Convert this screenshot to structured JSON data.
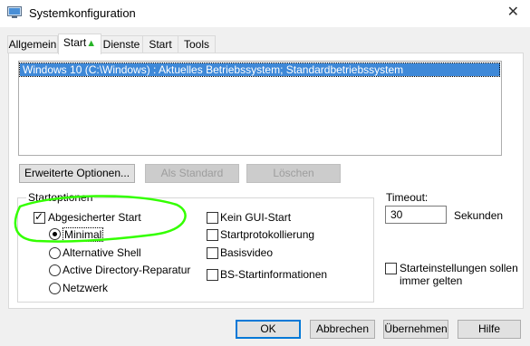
{
  "window": {
    "title": "Systemkonfiguration",
    "close_glyph": "✕"
  },
  "tabs": [
    {
      "label": "Allgemein"
    },
    {
      "label": "Start"
    },
    {
      "label": "Dienste"
    },
    {
      "label": "Start"
    },
    {
      "label": "Tools"
    }
  ],
  "os_list": {
    "items": [
      "Windows 10 (C:\\Windows) : Aktuelles Betriebssystem; Standardbetriebssystem"
    ]
  },
  "buttons": {
    "advanced": "Erweiterte Optionen...",
    "set_default": "Als Standard",
    "delete": "Löschen",
    "ok": "OK",
    "cancel": "Abbrechen",
    "apply": "Übernehmen",
    "help": "Hilfe"
  },
  "boot_options": {
    "group_title": "Startoptionen",
    "safe_boot": "Abgesicherter Start",
    "minimal": "Minimal",
    "alt_shell": "Alternative Shell",
    "ad_repair": "Active Directory-Reparatur",
    "network": "Netzwerk",
    "no_gui": "Kein GUI-Start",
    "boot_log": "Startprotokollierung",
    "base_video": "Basisvideo",
    "os_boot_info": "BS-Startinformationen"
  },
  "timeout": {
    "label": "Timeout:",
    "value": "30",
    "unit": "Sekunden"
  },
  "make_permanent": {
    "line1": "Starteinstellungen sollen",
    "line2": "immer gelten"
  },
  "colors": {
    "selection": "#3f89d8",
    "annotation": "#33ff00",
    "default_button_border": "#0078d7"
  }
}
